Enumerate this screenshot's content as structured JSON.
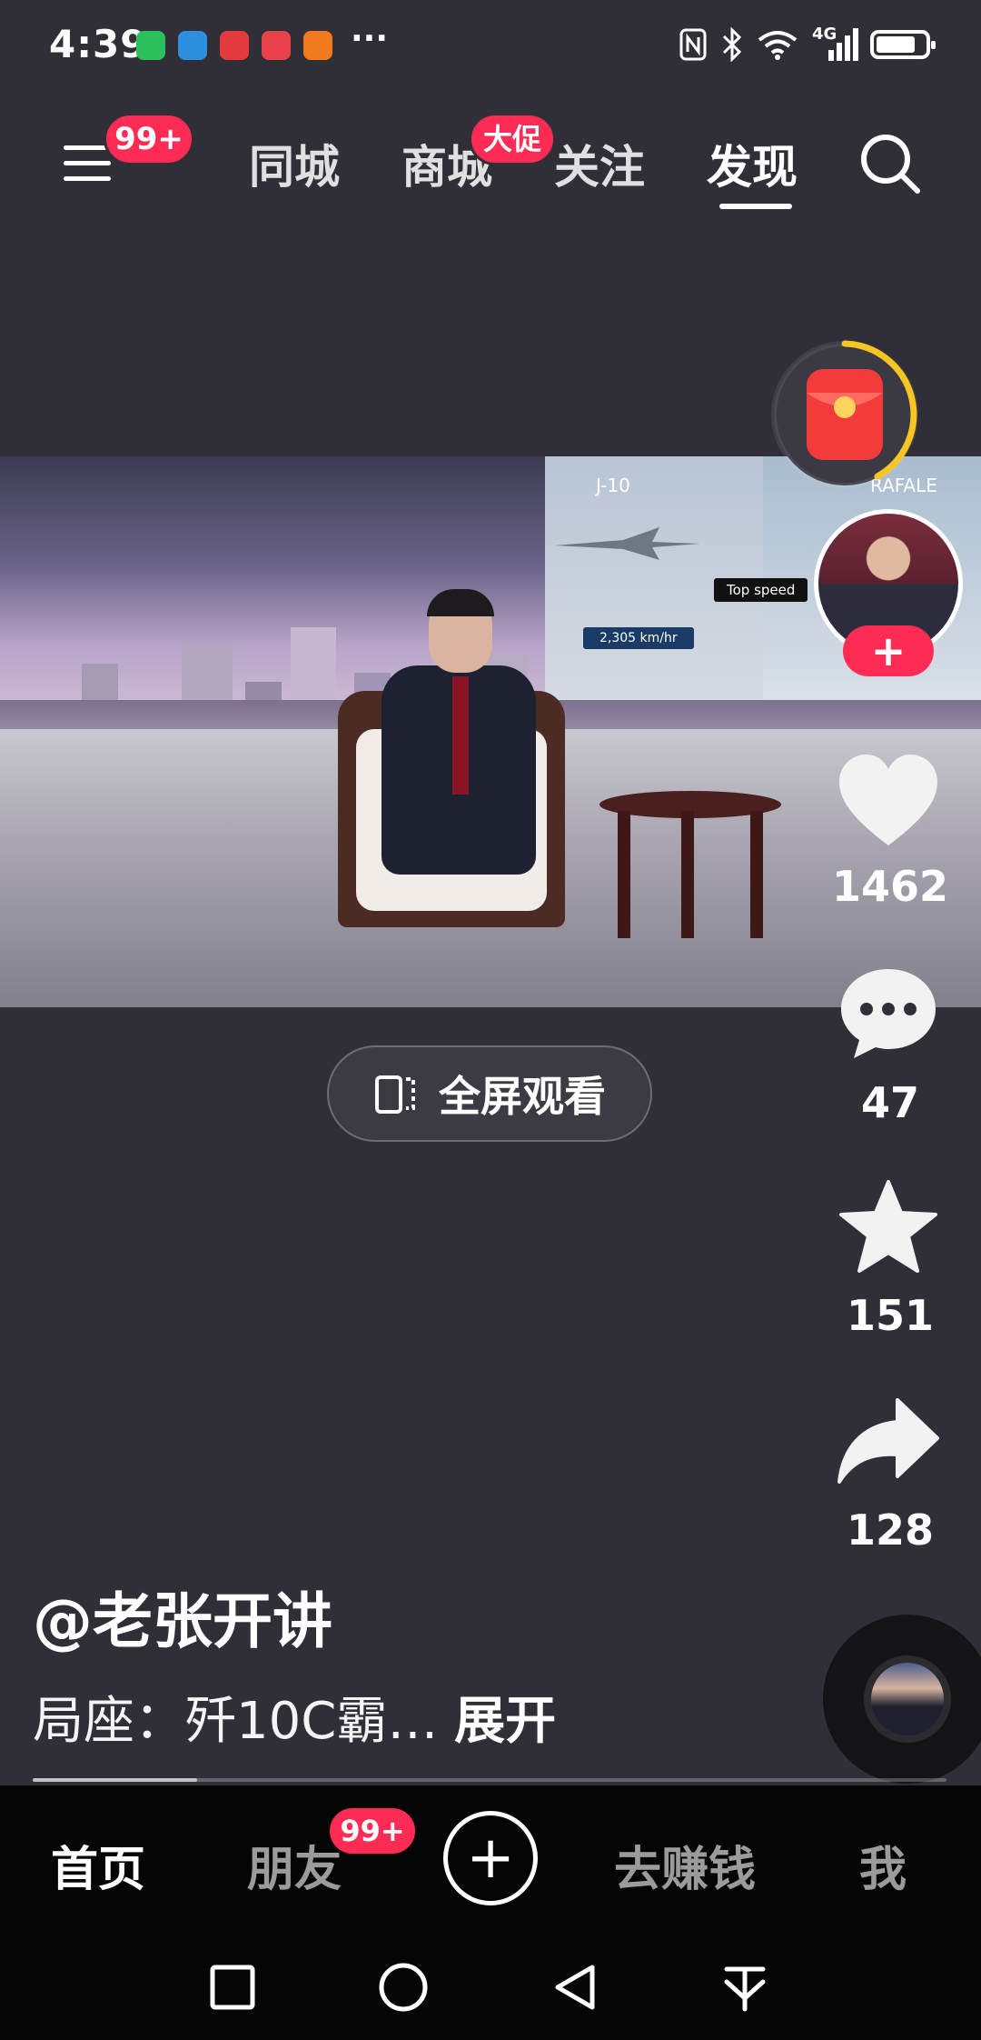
{
  "status_bar": {
    "time": "4:39",
    "more": "···",
    "network": "4G"
  },
  "top_nav": {
    "menu_badge": "99+",
    "tabs": [
      "同城",
      "商城",
      "关注",
      "发现"
    ],
    "active_tab": "发现",
    "mall_badge": "大促"
  },
  "video": {
    "overlay_left": "J-10",
    "overlay_right": "RAFALE",
    "speed_label": "Top speed",
    "speed_value": "2,305 km/hr"
  },
  "fullscreen": {
    "label": "全屏观看"
  },
  "actions": {
    "likes": "1462",
    "comments": "47",
    "favorites": "151",
    "shares": "128"
  },
  "post": {
    "author": "@老张开讲",
    "description": "局座：歼10C霸…",
    "expand": "展开",
    "progress": 0.18
  },
  "bottom_nav": {
    "home": "首页",
    "friends": "朋友",
    "friends_badge": "99+",
    "create": "+",
    "earn": "去赚钱",
    "me": "我"
  },
  "colors": {
    "background": "#302f38",
    "accent": "#fe2c55",
    "nav_bg": "#050506",
    "redpacket_ring": "#f7c521"
  }
}
